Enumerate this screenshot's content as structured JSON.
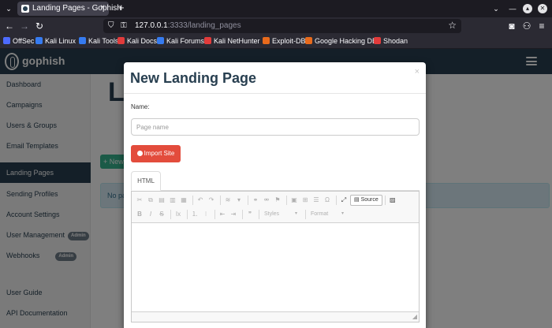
{
  "browser": {
    "tab_title": "Landing Pages - Gophish",
    "tab_close": "×",
    "new_tab": "+",
    "url_host": "127.0.0.1",
    "url_rest": ":3333/landing_pages",
    "bookmarks": [
      "OffSec",
      "Kali Linux",
      "Kali Tools",
      "Kali Docs",
      "Kali Forums",
      "Kali NetHunter",
      "Exploit-DB",
      "Google Hacking DB",
      "Shodan"
    ]
  },
  "app": {
    "logo_text": "gophish",
    "page_heading": "La",
    "new_page_button": "+ New Page",
    "empty_message": "No pages created yet. Let's create one!"
  },
  "sidebar": {
    "items": [
      {
        "label": "Dashboard"
      },
      {
        "label": "Campaigns"
      },
      {
        "label": "Users & Groups"
      },
      {
        "label": "Email Templates"
      },
      {
        "label": "Landing Pages",
        "active": true
      },
      {
        "label": "Sending Profiles"
      },
      {
        "label": "Account Settings"
      },
      {
        "label": "User Management",
        "badge": "Admin"
      },
      {
        "label": "Webhooks",
        "badge": "Admin"
      },
      {
        "label": "User Guide"
      },
      {
        "label": "API Documentation"
      }
    ]
  },
  "modal": {
    "title": "New Landing Page",
    "close": "×",
    "name_label": "Name:",
    "name_placeholder": "Page name",
    "name_value": "",
    "import_button": "Import Site",
    "editor_tab": "HTML",
    "source_button": "Source",
    "styles_placeholder": "Styles",
    "format_placeholder": "Format"
  },
  "colors": {
    "navbar": "#283f50",
    "active_item": "#283f50",
    "import_button": "#e34c3c",
    "new_button": "#37b48e"
  }
}
